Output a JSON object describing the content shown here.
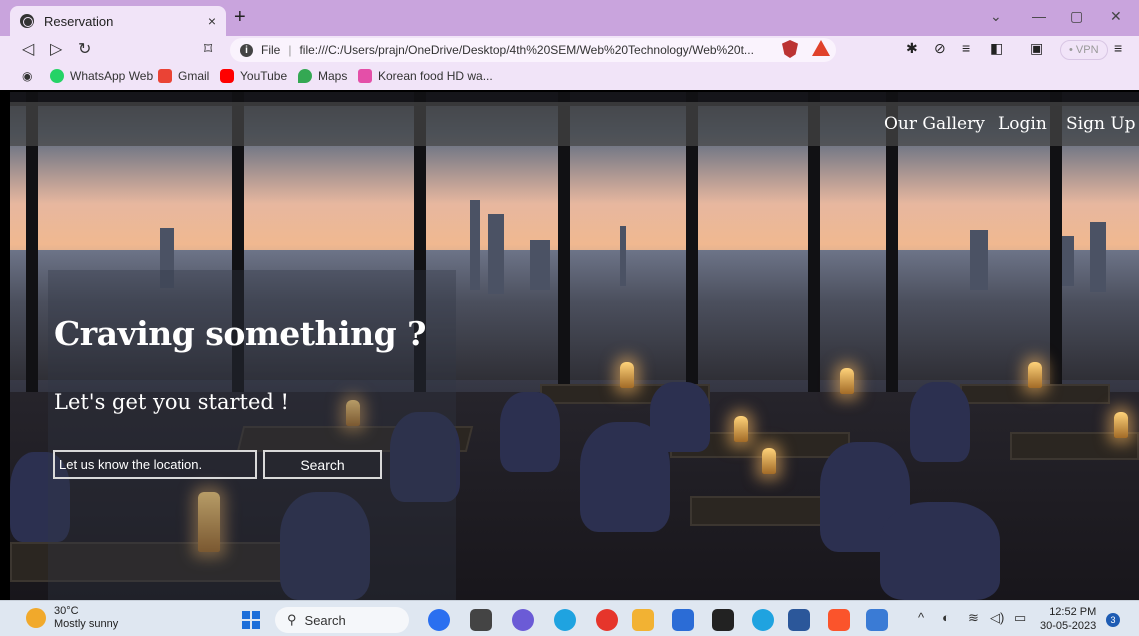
{
  "browser": {
    "tab_title": "Reservation",
    "tab_close": "×",
    "new_tab": "+",
    "address_prefix": "File",
    "address_url": "file:///C:/Users/prajn/OneDrive/Desktop/4th%20SEM/Web%20Technology/Web%20t...",
    "vpn_label": "• VPN",
    "bookmarks": [
      {
        "label": "WhatsApp Web",
        "color": "#25d366"
      },
      {
        "label": "Gmail",
        "color": "#ea4335"
      },
      {
        "label": "YouTube",
        "color": "#ff0000"
      },
      {
        "label": "Maps",
        "color": "#34a853"
      },
      {
        "label": "Korean food HD wa...",
        "color": "#e44fa8"
      }
    ]
  },
  "site": {
    "nav": {
      "gallery": "Our Gallery",
      "login": "Login",
      "signup": "Sign Up"
    },
    "hero": {
      "title": "Craving something ?",
      "subtitle": "Let's get you started !",
      "location_placeholder": "Let us know the location.",
      "search_label": "Search"
    }
  },
  "taskbar": {
    "weather_temp": "30°C",
    "weather_desc": "Mostly sunny",
    "search_label": "Search",
    "time": "12:52 PM",
    "date": "30-05-2023",
    "notification_count": "3"
  }
}
